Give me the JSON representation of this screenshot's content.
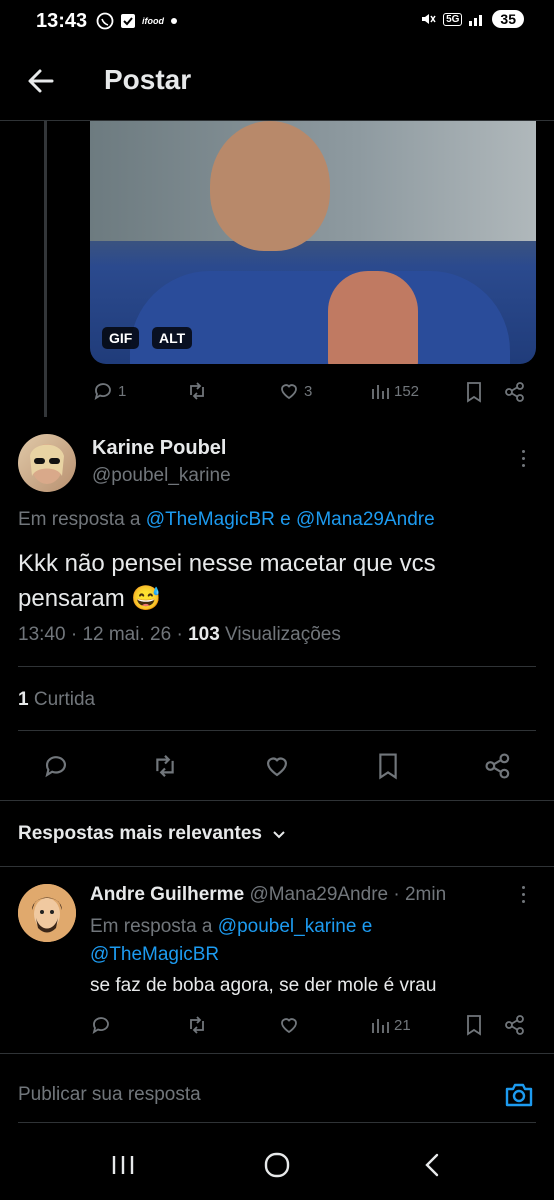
{
  "status_bar": {
    "time": "13:43",
    "network": "5G",
    "battery": "35"
  },
  "header": {
    "title": "Postar"
  },
  "parent_media": {
    "badge_gif": "GIF",
    "badge_alt": "ALT"
  },
  "parent_actions": {
    "replies": "1",
    "likes": "3",
    "views": "152"
  },
  "post": {
    "author_name": "Karine Poubel",
    "author_handle": "@poubel_karine",
    "reply_prefix": "Em resposta a",
    "reply_to_1": "@TheMagicBR",
    "reply_conj": "e",
    "reply_to_2": "@Mana29Andre",
    "text": "Kkk não pensei nesse macetar que vcs pensaram 😅",
    "time": "13:40",
    "date": "12 mai. 26",
    "views_count": "103",
    "views_label": "Visualizações",
    "likes_count": "1",
    "likes_label": "Curtida"
  },
  "sort": {
    "label": "Respostas mais relevantes"
  },
  "reply": {
    "author_name": "Andre Guilherme",
    "author_handle": "@Mana29Andre",
    "time": "2min",
    "reply_prefix": "Em resposta a",
    "reply_to_1": "@poubel_karine",
    "reply_conj": "e",
    "reply_to_2": "@TheMagicBR",
    "text": "se faz de boba agora, se der mole é vrau",
    "views": "21"
  },
  "composer": {
    "placeholder": "Publicar sua resposta"
  },
  "colors": {
    "background": "#000000",
    "accent": "#1d9bf0",
    "muted": "#71767b",
    "text": "#e7e9ea"
  }
}
